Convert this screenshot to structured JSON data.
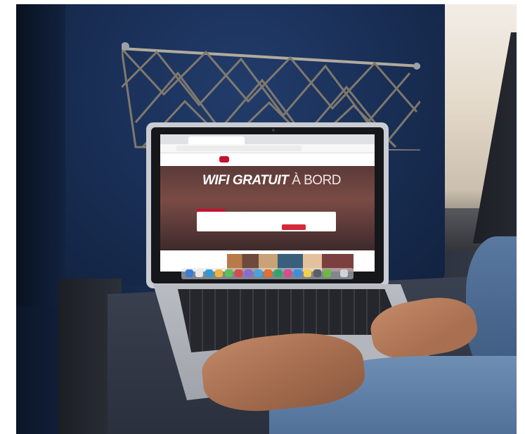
{
  "photo": {
    "screen": {
      "hero_title_bold": "WIFI GRATUIT",
      "hero_title_thin": "À BORD"
    }
  },
  "colors": {
    "seat": "#1a3058",
    "brand_red": "#c8102e",
    "laptop_silver": "#c9ccd1",
    "sleeve": "#5f7fa8"
  }
}
